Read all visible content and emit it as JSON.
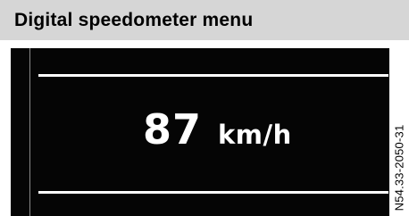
{
  "header": {
    "title": "Digital speedometer menu"
  },
  "display": {
    "speed_value": "87",
    "speed_unit": "km/h"
  },
  "figure": {
    "reference_code": "N54.33-2050-31"
  },
  "colors": {
    "header_background": "#d6d6d6",
    "display_background": "#050505",
    "display_foreground": "#ffffff"
  }
}
